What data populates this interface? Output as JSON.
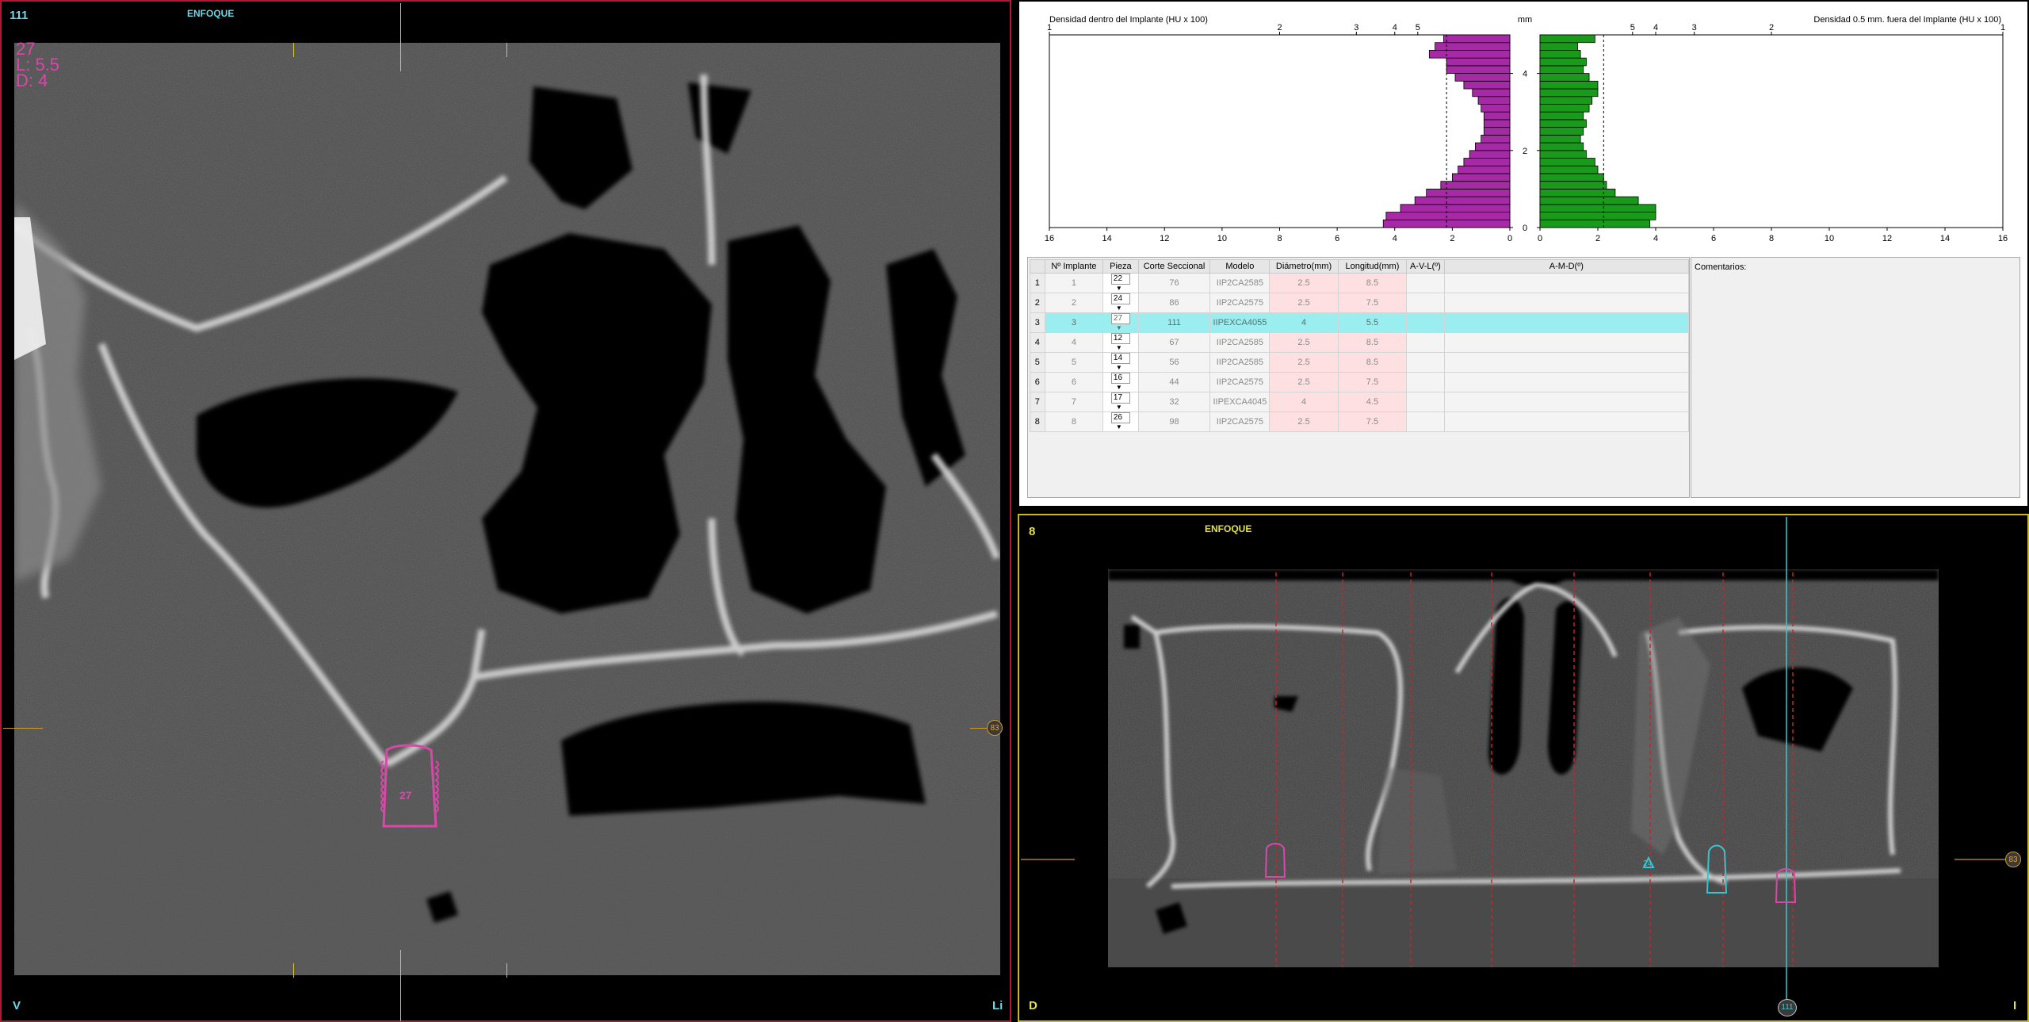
{
  "left_viewer": {
    "slice_number": "111",
    "focus_label": "ENFOQUE",
    "implant_tooth": "27",
    "implant_length": "L: 5.5",
    "implant_diameter": "D: 4",
    "corner_bottom_left": "V",
    "corner_bottom_right": "Li",
    "ref_marker": "83",
    "implant_tag": "27"
  },
  "chart_panel": {
    "chart_data": [
      {
        "type": "bar",
        "title": "Densidad dentro del Implante (HU x 100)",
        "orientation": "horizontal",
        "direction": "right-to-left",
        "top_axis_ticks": [
          "1",
          "2",
          "3",
          "4",
          "5"
        ],
        "bottom_axis_ticks": [
          "16",
          "14",
          "12",
          "10",
          "8",
          "6",
          "4",
          "2",
          "0"
        ],
        "y_label": "mm",
        "y_ticks": [
          "0",
          "2",
          "4"
        ],
        "ylim": [
          0,
          5
        ],
        "xlim": [
          0,
          16
        ],
        "mean_line": 2.2,
        "y": [
          0.1,
          0.3,
          0.5,
          0.7,
          0.9,
          1.1,
          1.3,
          1.5,
          1.7,
          1.9,
          2.1,
          2.3,
          2.5,
          2.7,
          2.9,
          3.1,
          3.3,
          3.5,
          3.7,
          3.9,
          4.1,
          4.3,
          4.5,
          4.7,
          4.9
        ],
        "values": [
          4.4,
          4.3,
          3.8,
          3.3,
          2.9,
          2.4,
          2.0,
          1.8,
          1.6,
          1.4,
          1.2,
          1.0,
          0.9,
          0.9,
          0.9,
          1.0,
          1.1,
          1.3,
          1.6,
          1.9,
          2.2,
          2.2,
          2.8,
          2.6,
          2.3
        ],
        "color": "#a62aa6"
      },
      {
        "type": "bar",
        "title": "Densidad 0.5 mm. fuera del Implante (HU x 100)",
        "orientation": "horizontal",
        "direction": "left-to-right",
        "top_axis_ticks": [
          "5",
          "4",
          "3",
          "2",
          "1"
        ],
        "bottom_axis_ticks": [
          "0",
          "2",
          "4",
          "6",
          "8",
          "10",
          "12",
          "14",
          "16"
        ],
        "ylim": [
          0,
          5
        ],
        "xlim": [
          0,
          16
        ],
        "mean_line": 2.2,
        "y": [
          0.1,
          0.3,
          0.5,
          0.7,
          0.9,
          1.1,
          1.3,
          1.5,
          1.7,
          1.9,
          2.1,
          2.3,
          2.5,
          2.7,
          2.9,
          3.1,
          3.3,
          3.5,
          3.7,
          3.9,
          4.1,
          4.3,
          4.5,
          4.7,
          4.9
        ],
        "values": [
          3.8,
          4.0,
          4.0,
          3.4,
          2.6,
          2.3,
          2.2,
          2.0,
          1.9,
          1.6,
          1.5,
          1.4,
          1.5,
          1.6,
          1.5,
          1.7,
          1.8,
          2.0,
          2.0,
          1.7,
          1.5,
          1.6,
          1.4,
          1.3,
          1.9
        ],
        "color": "#1a9a1a"
      }
    ],
    "table": {
      "headers": [
        "Nº Implante",
        "Pieza",
        "Corte Seccional",
        "Modelo",
        "Diámetro(mm)",
        "Longitud(mm)",
        "A-V-L(º)",
        "A-M-D(º)"
      ],
      "rows": [
        {
          "row": "1",
          "implant": "1",
          "pieza": "22",
          "corte": "76",
          "modelo": "IIP2CA2585",
          "diametro": "2.5",
          "longitud": "8.5",
          "avl": "",
          "amd": ""
        },
        {
          "row": "2",
          "implant": "2",
          "pieza": "24",
          "corte": "86",
          "modelo": "IIP2CA2575",
          "diametro": "2.5",
          "longitud": "7.5",
          "avl": "",
          "amd": ""
        },
        {
          "row": "3",
          "implant": "3",
          "pieza": "27",
          "corte": "111",
          "modelo": "IIPEXCA4055",
          "diametro": "4",
          "longitud": "5.5",
          "avl": "",
          "amd": ""
        },
        {
          "row": "4",
          "implant": "4",
          "pieza": "12",
          "corte": "67",
          "modelo": "IIP2CA2585",
          "diametro": "2.5",
          "longitud": "8.5",
          "avl": "",
          "amd": ""
        },
        {
          "row": "5",
          "implant": "5",
          "pieza": "14",
          "corte": "56",
          "modelo": "IIP2CA2585",
          "diametro": "2.5",
          "longitud": "8.5",
          "avl": "",
          "amd": ""
        },
        {
          "row": "6",
          "implant": "6",
          "pieza": "16",
          "corte": "44",
          "modelo": "IIP2CA2575",
          "diametro": "2.5",
          "longitud": "7.5",
          "avl": "",
          "amd": ""
        },
        {
          "row": "7",
          "implant": "7",
          "pieza": "17",
          "corte": "32",
          "modelo": "IIPEXCA4045",
          "diametro": "4",
          "longitud": "4.5",
          "avl": "",
          "amd": ""
        },
        {
          "row": "8",
          "implant": "8",
          "pieza": "26",
          "corte": "98",
          "modelo": "IIP2CA2575",
          "diametro": "2.5",
          "longitud": "7.5",
          "avl": "",
          "amd": ""
        }
      ],
      "selected_row": 3
    },
    "comments_label": "Comentarios:"
  },
  "bottom_viewer": {
    "slice_number": "8",
    "focus_label": "ENFOQUE",
    "corner_bottom_left": "D",
    "corner_bottom_right": "I",
    "ref_marker_right": "83",
    "ref_marker_bottom": "111"
  },
  "colors": {
    "left_border": "#b01a30",
    "bottom_border": "#c9b72a",
    "implant_magenta": "#d848a8",
    "implant_cyan": "#30c8d0",
    "slice_label_cyan": "#6ad8e6",
    "focus_yellow": "#e6e24a",
    "selected_row": "#9aeef0",
    "pink_cell": "#ffe0e2"
  }
}
